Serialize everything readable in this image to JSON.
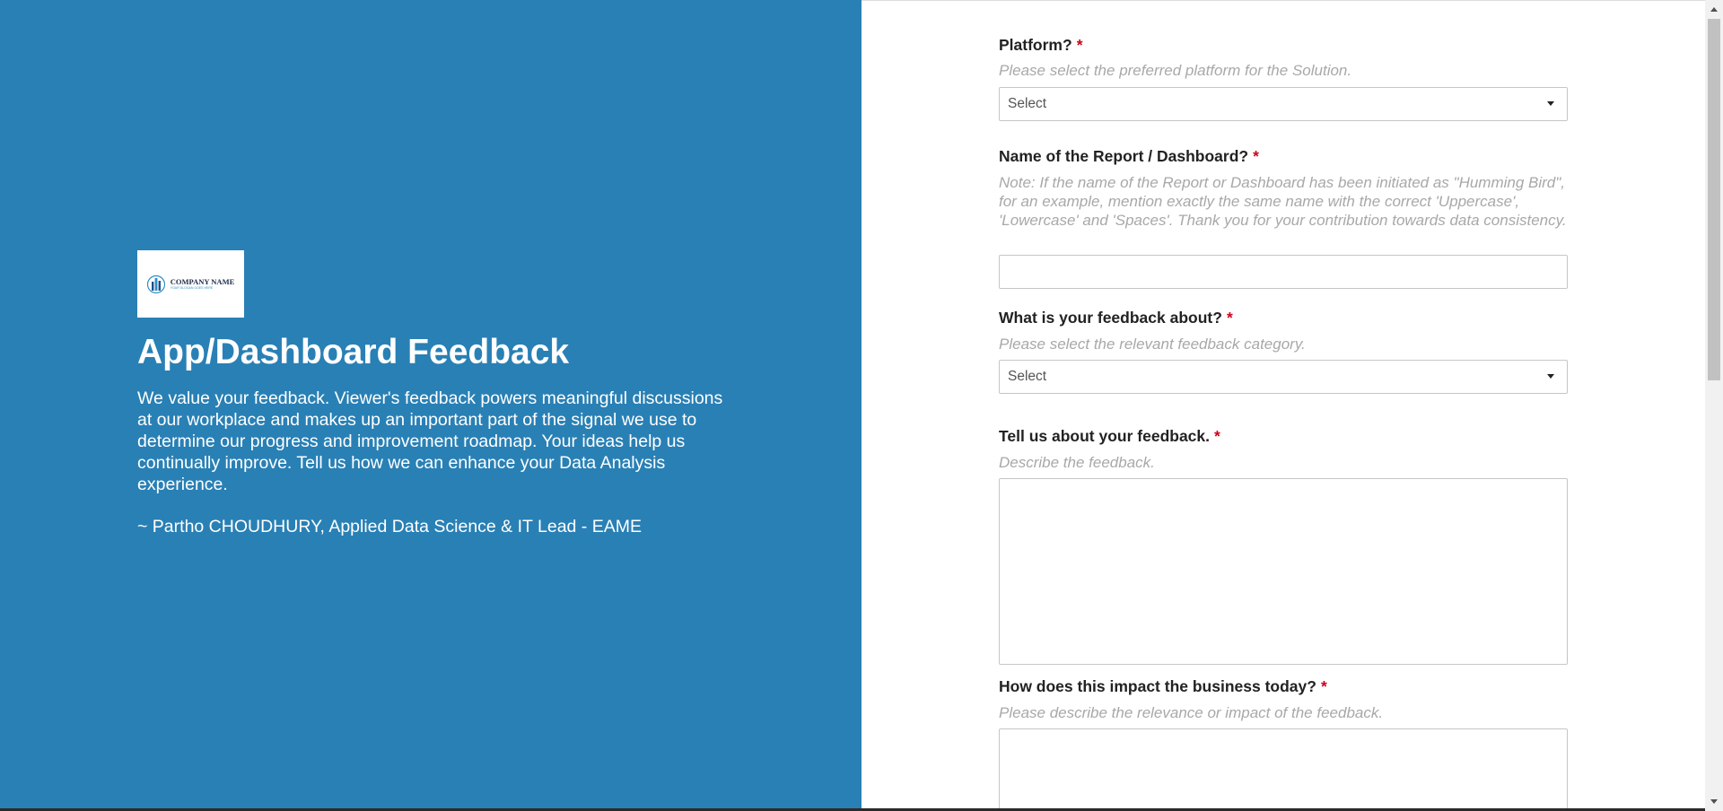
{
  "intro": {
    "logo_name": "COMPANY NAME",
    "logo_tagline": "YOUR SLOGAN GOES HERE",
    "title": "App/Dashboard Feedback",
    "description": "We value your feedback. Viewer's feedback powers meaningful discussions at our workplace and makes up an important part of the signal we use to determine our progress and improvement roadmap. Your ideas help us continually improve. Tell us how we can enhance your Data Analysis experience.",
    "signature": "~ Partho CHOUDHURY, Applied Data Science & IT Lead - EAME"
  },
  "form": {
    "required_marker": "*",
    "platform": {
      "label": "Platform?",
      "help": "Please select the preferred platform for the Solution.",
      "value": "Select"
    },
    "report_name": {
      "label": "Name of the Report / Dashboard?",
      "help": "Note: If the name of the Report or Dashboard has been initiated as \"Humming Bird\", for an example, mention exactly the same name with the correct 'Uppercase', 'Lowercase' and 'Spaces'. Thank you for your contribution towards data consistency.",
      "value": ""
    },
    "feedback_about": {
      "label": "What is your feedback about?",
      "help": "Please select the relevant feedback category.",
      "value": "Select"
    },
    "feedback_detail": {
      "label": "Tell us about your feedback.",
      "help": "Describe the feedback.",
      "value": ""
    },
    "business_impact": {
      "label": "How does this impact the business today?",
      "help": "Please describe the relevance or impact of the feedback.",
      "value": ""
    }
  },
  "colors": {
    "panel_background": "#2980b5",
    "required": "#d0021b",
    "help_text": "#a8a8a8"
  }
}
